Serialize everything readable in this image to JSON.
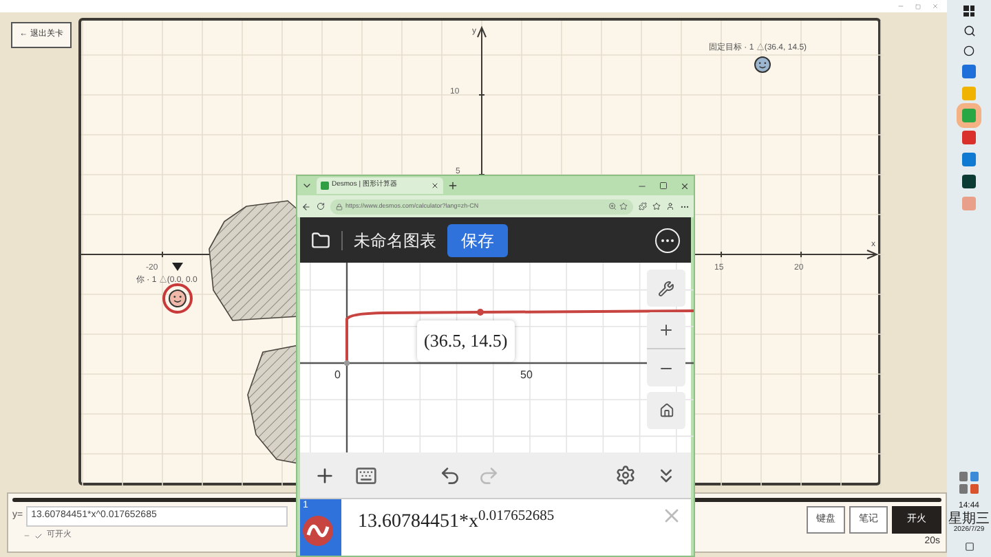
{
  "back_button": "← 退出关卡",
  "canvas": {
    "x_axis": {
      "label": "x",
      "ticks": [
        "-20",
        "15",
        "20"
      ]
    },
    "y_axis": {
      "label": "y",
      "ticks": [
        "10",
        "5"
      ]
    },
    "target": {
      "label": "固定目标 · 1",
      "coords": "△(36.4, 14.5)"
    },
    "player": {
      "label": "你 · 1",
      "coords": "△(0.0, 0.0"
    }
  },
  "equation": {
    "prefix": "y=",
    "value": "13.60784451*x^0.017652685",
    "status": "可开火",
    "can_fire": true
  },
  "timer": {
    "level": 1,
    "reading": "20s"
  },
  "buttons": [
    {
      "label": "键盘",
      "kind": "outline"
    },
    {
      "label": "笔记",
      "kind": "outline"
    },
    {
      "label": "开火",
      "kind": "primary"
    }
  ],
  "browser": {
    "tab_title": "Desmos | 图形计算器",
    "url": "https://www.desmos.com/calculator?lang=zh-CN",
    "graph_title": "未命名图表",
    "save": "保存",
    "point_label": "(36.5, 14.5)",
    "axis_ticks": [
      "0",
      "50"
    ],
    "expression": {
      "index": "1",
      "text": "13.60784451*x$^{0.017652685}$"
    }
  },
  "taskbar": {
    "time": "14:44",
    "weekday": "星期三",
    "date": "2026/7/29"
  }
}
